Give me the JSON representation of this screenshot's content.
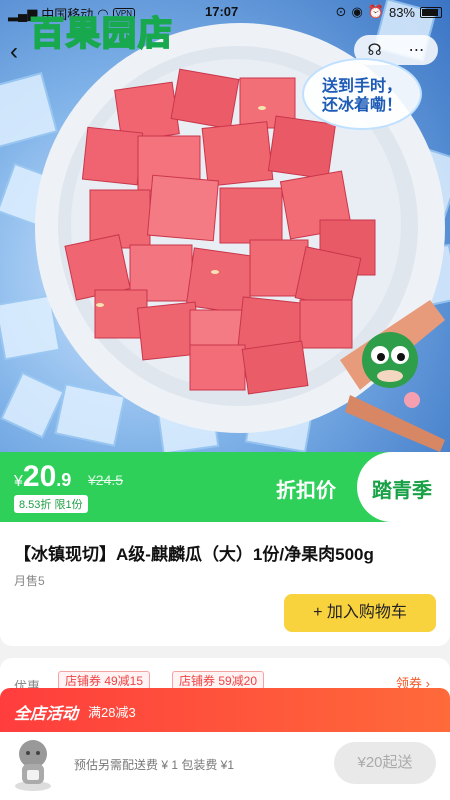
{
  "status_bar": {
    "carrier": "中国移动",
    "vpn": "VPN",
    "time": "17:07",
    "battery": "83%"
  },
  "header": {
    "store_logo": "百果园店",
    "bubble_line1": "送到手时，",
    "bubble_line2": "还冰着嘞！"
  },
  "icons": {
    "back": "chevron-left-icon",
    "service": "customer-service-icon",
    "more": "more-icon",
    "cart": "cart-character-icon"
  },
  "price": {
    "currency": "¥",
    "integer": "20",
    "decimal": ".9",
    "original": "¥24.5",
    "discount": "8.53折 限1份",
    "promo_tag": "折扣价",
    "season_tag": "踏青季"
  },
  "product": {
    "title": "【冰镇现切】A级-麒麟瓜（大）1份/净果肉500g",
    "monthly_sales": "月售5",
    "add_to_cart": "+ 加入购物车"
  },
  "coupons": {
    "label": "优惠",
    "items": [
      "店铺券 49减15",
      "店铺券 59减20"
    ],
    "link": "领券 ›"
  },
  "activity": {
    "title": "全店活动",
    "desc": "满28减3"
  },
  "bottom_bar": {
    "fees": "预估另需配送费 ¥ 1  包装费 ¥1",
    "checkout": "¥20起送"
  },
  "colors": {
    "brand_green": "#2fd05a",
    "cart_yellow": "#f9d33e",
    "activity_red": "#ff3d3d"
  }
}
